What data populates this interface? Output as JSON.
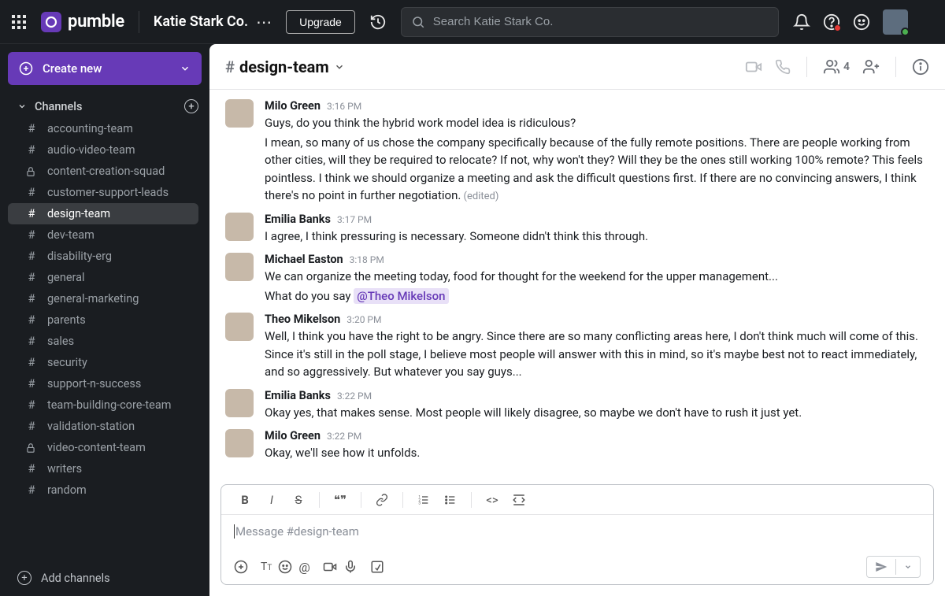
{
  "brand": {
    "name": "pumble"
  },
  "workspace": {
    "name": "Katie Stark Co."
  },
  "topbar": {
    "upgrade_label": "Upgrade",
    "search_placeholder": "Search Katie Stark Co."
  },
  "sidebar": {
    "create_label": "Create new",
    "section_label": "Channels",
    "add_channels_label": "Add channels",
    "channels": [
      {
        "name": "accounting-team",
        "icon": "hash"
      },
      {
        "name": "audio-video-team",
        "icon": "hash"
      },
      {
        "name": "content-creation-squad",
        "icon": "lock"
      },
      {
        "name": "customer-support-leads",
        "icon": "hash"
      },
      {
        "name": "design-team",
        "icon": "hash",
        "active": true
      },
      {
        "name": "dev-team",
        "icon": "hash"
      },
      {
        "name": "disability-erg",
        "icon": "hash"
      },
      {
        "name": "general",
        "icon": "hash"
      },
      {
        "name": "general-marketing",
        "icon": "hash"
      },
      {
        "name": "parents",
        "icon": "hash"
      },
      {
        "name": "sales",
        "icon": "hash"
      },
      {
        "name": "security",
        "icon": "hash"
      },
      {
        "name": "support-n-success",
        "icon": "hash"
      },
      {
        "name": "team-building-core-team",
        "icon": "hash"
      },
      {
        "name": "validation-station",
        "icon": "hash"
      },
      {
        "name": "video-content-team",
        "icon": "lock"
      },
      {
        "name": "writers",
        "icon": "hash"
      },
      {
        "name": "random",
        "icon": "hash"
      }
    ]
  },
  "channel_header": {
    "name": "design-team",
    "member_count": "4"
  },
  "messages": [
    {
      "author": "Milo Green",
      "time": "3:16 PM",
      "avatar_class": "avc1",
      "lines": [
        "Guys, do you think the hybrid work model idea is ridiculous?",
        "I mean, so many of us chose the company specifically because of the fully remote positions. There are people working from other cities, will they be required to relocate? If not, why won't they? Will they be the ones still working 100% remote? This feels pointless. I think we should organize a meeting and ask the difficult questions first. If there are no convincing answers, I think there's no point in further negotiation."
      ],
      "edited": true
    },
    {
      "author": "Emilia Banks",
      "time": "3:17 PM",
      "avatar_class": "avc2",
      "lines": [
        "I agree, I think pressuring is necessary. Someone didn't think this through."
      ]
    },
    {
      "author": "Michael Easton",
      "time": "3:18 PM",
      "avatar_class": "avc3",
      "lines": [
        "We can organize the meeting today, food for thought for the weekend for the upper management...",
        "What do you say "
      ],
      "mention": "@Theo Mikelson"
    },
    {
      "author": "Theo Mikelson",
      "time": "3:20 PM",
      "avatar_class": "avc4",
      "lines": [
        "Well, I think you have the right to be angry. Since there are so many conflicting areas here, I don't think much will come of this. Since it's still in the poll stage, I believe most people will answer with this in mind, so it's maybe best not to react immediately, and so aggressively. But whatever you say guys..."
      ]
    },
    {
      "author": "Emilia Banks",
      "time": "3:22 PM",
      "avatar_class": "avc5",
      "lines": [
        "Okay yes, that makes sense. Most people will likely disagree, so maybe we don't have to rush it just yet."
      ]
    },
    {
      "author": "Milo Green",
      "time": "3:22 PM",
      "avatar_class": "avc6",
      "lines": [
        "Okay, we'll see how it unfolds."
      ]
    }
  ],
  "composer": {
    "placeholder": "Message #design-team",
    "edited_label": "(edited)"
  }
}
